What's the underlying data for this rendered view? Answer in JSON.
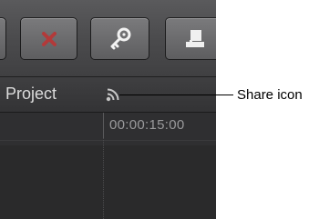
{
  "header": {
    "project_title": "Project"
  },
  "ruler": {
    "timecode": "00:00:15:00"
  },
  "toolbar": {
    "buttons": [
      {
        "icon": "reject-x-icon",
        "color": "#b23a3a"
      },
      {
        "icon": "key-icon"
      },
      {
        "icon": "export-icon"
      }
    ]
  },
  "callout": {
    "label": "Share icon"
  }
}
